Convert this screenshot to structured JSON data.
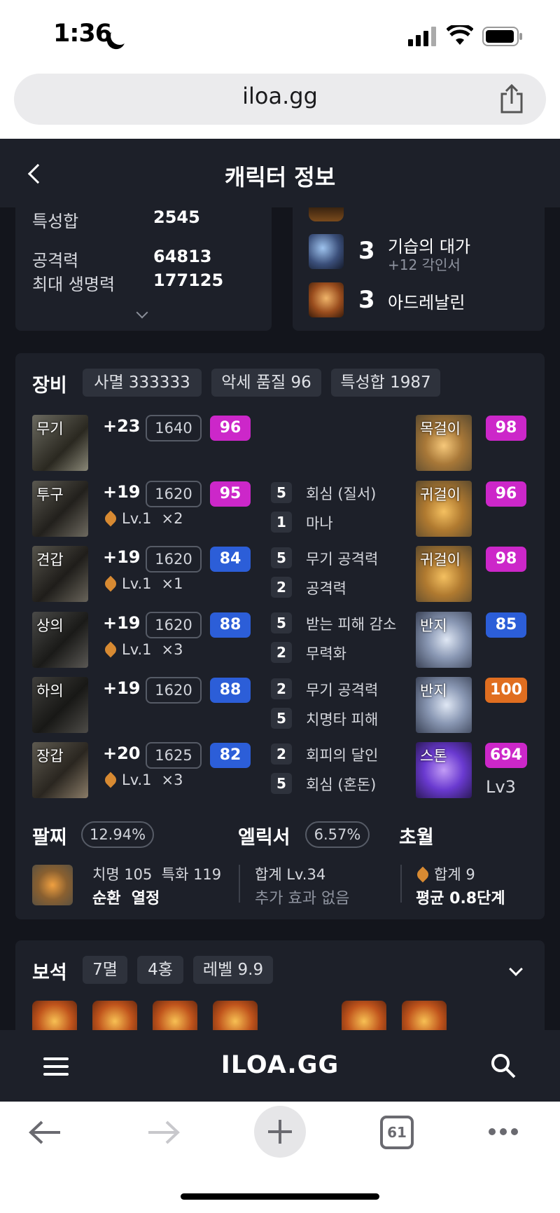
{
  "status_bar": {
    "time": "1:36"
  },
  "browser": {
    "url": "iloa.gg",
    "tab_count": "61"
  },
  "header": {
    "title": "캐릭터 정보"
  },
  "stats": [
    {
      "label": "특성합",
      "value": "2545"
    },
    {
      "label": "공격력",
      "value": "64813"
    },
    {
      "label": "최대 생명력",
      "value": "177125"
    }
  ],
  "engravings": [
    {
      "level": "3",
      "name": "기습의 대가",
      "sub": "+12 각인서"
    },
    {
      "level": "3",
      "name": "아드레날린",
      "sub": ""
    }
  ],
  "equipment": {
    "title": "장비",
    "chips": [
      "사멸 333333",
      "악세 품질 96",
      "특성합 1987"
    ],
    "armor": [
      {
        "slot": "무기",
        "plus": "+23",
        "ilvl": "1640",
        "quality": "96",
        "qcolor": "#cc27c9",
        "lv": "",
        "mult": ""
      },
      {
        "slot": "투구",
        "plus": "+19",
        "ilvl": "1620",
        "quality": "95",
        "qcolor": "#cc27c9",
        "lv": "Lv.1",
        "mult": "×2"
      },
      {
        "slot": "견갑",
        "plus": "+19",
        "ilvl": "1620",
        "quality": "84",
        "qcolor": "#2c5ed8",
        "lv": "Lv.1",
        "mult": "×1"
      },
      {
        "slot": "상의",
        "plus": "+19",
        "ilvl": "1620",
        "quality": "88",
        "qcolor": "#2c5ed8",
        "lv": "Lv.1",
        "mult": "×3"
      },
      {
        "slot": "하의",
        "plus": "+19",
        "ilvl": "1620",
        "quality": "88",
        "qcolor": "#2c5ed8",
        "lv": "",
        "mult": ""
      },
      {
        "slot": "장갑",
        "plus": "+20",
        "ilvl": "1625",
        "quality": "82",
        "qcolor": "#2c5ed8",
        "lv": "Lv.1",
        "mult": "×3"
      }
    ],
    "effects": [
      {
        "n": "5",
        "t": "회심 (질서)"
      },
      {
        "n": "1",
        "t": "마나"
      },
      {
        "n": "5",
        "t": "무기 공격력"
      },
      {
        "n": "2",
        "t": "공격력"
      },
      {
        "n": "5",
        "t": "받는 피해 감소"
      },
      {
        "n": "2",
        "t": "무력화"
      },
      {
        "n": "2",
        "t": "무기 공격력"
      },
      {
        "n": "5",
        "t": "치명타 피해"
      },
      {
        "n": "2",
        "t": "회피의 달인"
      },
      {
        "n": "5",
        "t": "회심 (혼돈)"
      }
    ],
    "accessories": [
      {
        "slot": "목걸이",
        "quality": "98",
        "qcolor": "#cc27c9"
      },
      {
        "slot": "귀걸이",
        "quality": "96",
        "qcolor": "#cc27c9"
      },
      {
        "slot": "귀걸이",
        "quality": "98",
        "qcolor": "#cc27c9"
      },
      {
        "slot": "반지",
        "quality": "85",
        "qcolor": "#2c5ed8"
      },
      {
        "slot": "반지",
        "quality": "100",
        "qcolor": "#e06e20"
      },
      {
        "slot": "스톤",
        "quality": "694",
        "qcolor": "#cc27c9",
        "sub": "Lv3"
      }
    ]
  },
  "bracelet": {
    "title": "팔찌",
    "pct": "12.94%",
    "stats": "치명 105  특화 119",
    "effects": "순환  열정"
  },
  "elixir": {
    "title": "엘릭서",
    "pct": "6.57%",
    "total": "합계 Lv.34",
    "note": "추가 효과 없음"
  },
  "transcend": {
    "title": "초월",
    "total": "합계 9",
    "avg": "평균 0.8단계"
  },
  "gems": {
    "title": "보석",
    "chips": [
      "7멸",
      "4홍",
      "레벨 9.9"
    ]
  },
  "bottom_nav": {
    "logo": "ILOA.GG"
  }
}
